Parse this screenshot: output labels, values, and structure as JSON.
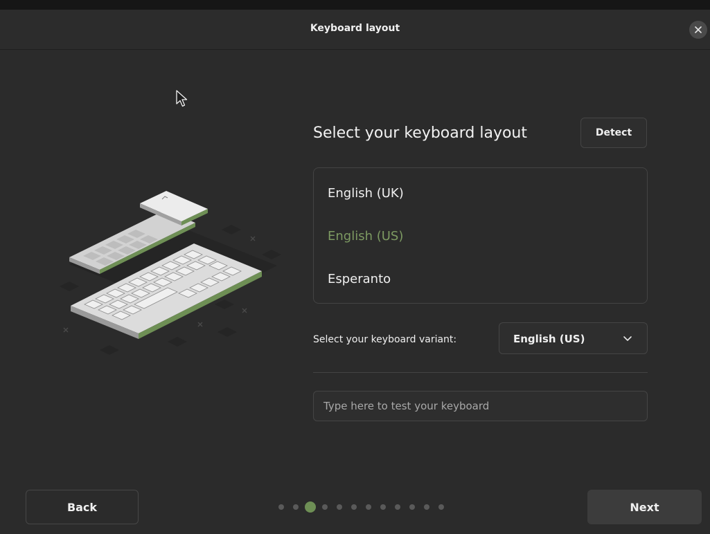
{
  "window": {
    "title": "Keyboard layout"
  },
  "main": {
    "heading": "Select your keyboard layout",
    "detect_label": "Detect",
    "layouts": [
      {
        "label": "English (UK)",
        "selected": false
      },
      {
        "label": "English (US)",
        "selected": true
      },
      {
        "label": "Esperanto",
        "selected": false
      }
    ],
    "variant_label": "Select your keyboard variant:",
    "variant_value": "English (US)",
    "test_placeholder": "Type here to test your keyboard"
  },
  "footer": {
    "back_label": "Back",
    "next_label": "Next",
    "step_count": 12,
    "current_step": 3
  },
  "colors": {
    "accent": "#7d9a62",
    "active_dot": "#6e8f55"
  },
  "icons": {
    "close": "close-icon",
    "chevron": "chevron-down-icon",
    "cursor": "mouse-pointer-icon",
    "illustration": "keyboard-illustration"
  }
}
